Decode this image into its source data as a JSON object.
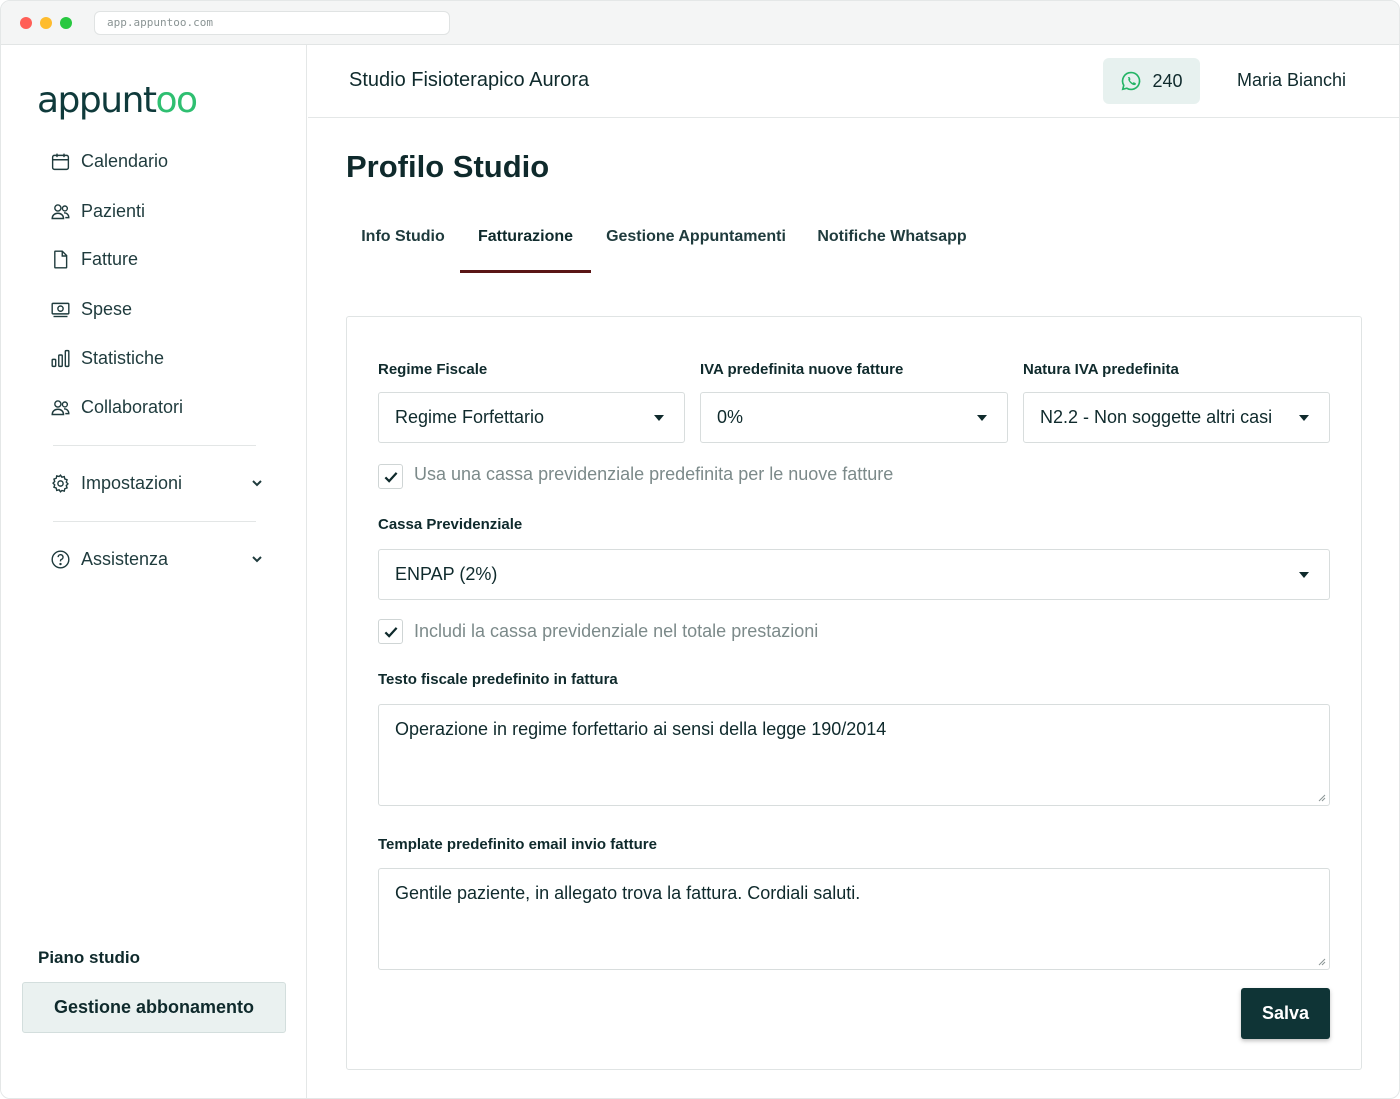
{
  "browser": {
    "url": "app.appuntoo.com"
  },
  "sidebar": {
    "logo_prefix": "appunt",
    "logo_suffix": "oo",
    "items": [
      {
        "label": "Calendario",
        "icon": "calendar-icon"
      },
      {
        "label": "Pazienti",
        "icon": "users-icon"
      },
      {
        "label": "Fatture",
        "icon": "file-icon"
      },
      {
        "label": "Spese",
        "icon": "cash-icon"
      },
      {
        "label": "Statistiche",
        "icon": "bar-chart-icon"
      },
      {
        "label": "Collaboratori",
        "icon": "users-icon"
      }
    ],
    "settings_label": "Impostazioni",
    "help_label": "Assistenza",
    "plan_label": "Piano studio",
    "plan_button": "Gestione abbonamento"
  },
  "header": {
    "studio_name": "Studio Fisioterapico Aurora",
    "whatsapp_count": "240",
    "user_name": "Maria Bianchi"
  },
  "page": {
    "title": "Profilo Studio",
    "tabs": [
      {
        "label": "Info Studio",
        "active": false
      },
      {
        "label": "Fatturazione",
        "active": true
      },
      {
        "label": "Gestione Appuntamenti",
        "active": false
      },
      {
        "label": "Notifiche Whatsapp",
        "active": false
      }
    ]
  },
  "form": {
    "regime_label": "Regime Fiscale",
    "regime_value": "Regime Forfettario",
    "iva_label": "IVA predefinita nuove fatture",
    "iva_value": "0%",
    "natura_label": "Natura IVA predefinita",
    "natura_value": "N2.2 - Non soggette altri casi",
    "use_cassa_label": "Usa una cassa previdenziale predefinita per le nuove fatture",
    "use_cassa_checked": true,
    "cassa_label": "Cassa Previdenziale",
    "cassa_value": "ENPAP (2%)",
    "include_cassa_label": "Includi la cassa previdenziale nel totale prestazioni",
    "include_cassa_checked": true,
    "testo_label": "Testo fiscale predefinito in fattura",
    "testo_value": "Operazione in regime forfettario ai sensi della legge 190/2014",
    "template_label": "Template predefinito email invio fatture",
    "template_value": "Gentile paziente, in allegato trova la fattura. Cordiali saluti.",
    "save_label": "Salva"
  },
  "colors": {
    "brand_dark": "#0f3436",
    "brand_green": "#2fbf71",
    "active_tab_underline": "#5a1515",
    "whatsapp_badge_bg": "#e7f1ef"
  }
}
